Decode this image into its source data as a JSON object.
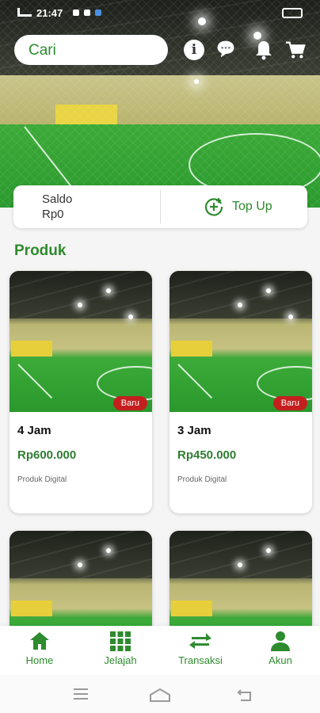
{
  "status_bar": {
    "time": "21:47"
  },
  "header": {
    "search_placeholder": "Cari",
    "icons": [
      "info-icon",
      "chat-icon",
      "bell-icon",
      "cart-icon"
    ]
  },
  "saldo": {
    "label": "Saldo",
    "amount": "Rp0",
    "topup_label": "Top Up"
  },
  "section": {
    "title": "Produk"
  },
  "products": [
    {
      "badge": "Baru",
      "name": "4 Jam",
      "price": "Rp600.000",
      "type": "Produk Digital"
    },
    {
      "badge": "Baru",
      "name": "3 Jam",
      "price": "Rp450.000",
      "type": "Produk Digital"
    }
  ],
  "bottom_nav": [
    {
      "label": "Home",
      "icon": "home-icon"
    },
    {
      "label": "Jelajah",
      "icon": "grid-icon"
    },
    {
      "label": "Transaksi",
      "icon": "transfer-icon"
    },
    {
      "label": "Akun",
      "icon": "user-icon"
    }
  ],
  "colors": {
    "accent": "#2e8b2e",
    "badge": "#c41f1f",
    "price": "#2e7d32"
  }
}
